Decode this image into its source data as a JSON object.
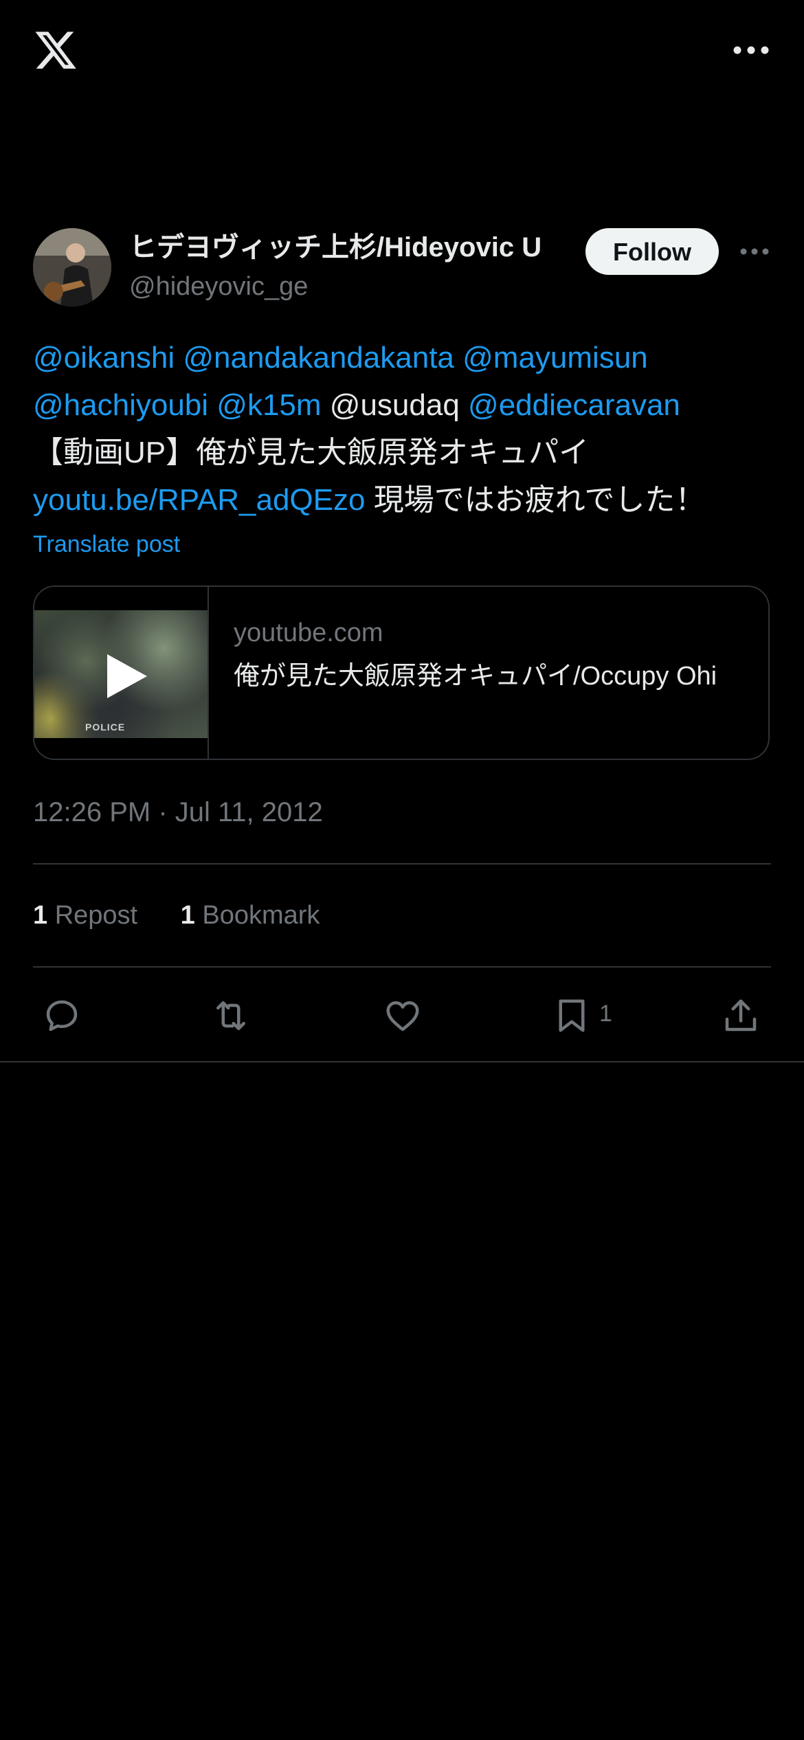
{
  "header": {
    "logo_icon": "x-logo-icon",
    "more_icon": "more-horizontal-icon"
  },
  "author": {
    "name": "ヒデヨヴィッチ上杉/Hideyovic U",
    "handle": "@hideyovic_ge",
    "follow_label": "Follow"
  },
  "tweet": {
    "m1": "@oikanshi",
    "m2": "@nandakandakanta",
    "m3": "@mayumisun",
    "m4": "@hachiyoubi",
    "m5": "@k15m",
    "m6": "@usudaq",
    "m7": "@eddiecaravan",
    "t1": "【動画UP】俺が見た大飯原発オキュパイ",
    "link": "youtu.be/RPAR_adQEzo",
    "t2": " 現場ではお疲れでした！",
    "translate_label": "Translate post"
  },
  "card": {
    "domain": "youtube.com",
    "title": "俺が見た大飯原発オキュパイ/Occupy Ohi",
    "thumb_label": "POLICE"
  },
  "timestamp": "12:26 PM · Jul 11, 2012",
  "stats": {
    "reposts": "1",
    "reposts_label": "Repost",
    "bookmarks": "1",
    "bookmarks_label": "Bookmark"
  },
  "actions": {
    "bookmark_count": "1"
  },
  "colors": {
    "background": "#000000",
    "text": "#e7e9ea",
    "muted": "#71767b",
    "link": "#1d9bf0",
    "divider": "#2f3336"
  }
}
